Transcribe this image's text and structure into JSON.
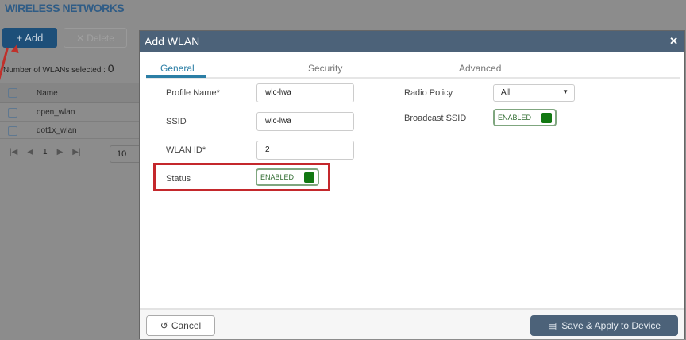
{
  "page": {
    "title": "WIRELESS NETWORKS",
    "add_label": "Add",
    "delete_label": "Delete",
    "selected_label": "Number of WLANs selected :",
    "selected_count": "0",
    "name_header": "Name",
    "rows": [
      "open_wlan",
      "dot1x_wlan"
    ],
    "page_number": "1",
    "per_page": "10"
  },
  "modal": {
    "title": "Add WLAN",
    "tabs": [
      "General",
      "Security",
      "Advanced"
    ],
    "fields": {
      "profile_name_label": "Profile Name*",
      "profile_name": "wlc-lwa",
      "ssid_label": "SSID",
      "ssid": "wlc-lwa",
      "wlan_id_label": "WLAN ID*",
      "wlan_id": "2",
      "status_label": "Status",
      "status": "ENABLED",
      "radio_policy_label": "Radio Policy",
      "radio_policy": "All",
      "broadcast_ssid_label": "Broadcast SSID",
      "broadcast_ssid": "ENABLED"
    },
    "cancel_label": "Cancel",
    "save_label": "Save & Apply to Device"
  },
  "colors": {
    "header": "#4c6279",
    "accent": "#2b7ea5",
    "toggle_on": "#127812",
    "highlight": "#c4282c"
  }
}
